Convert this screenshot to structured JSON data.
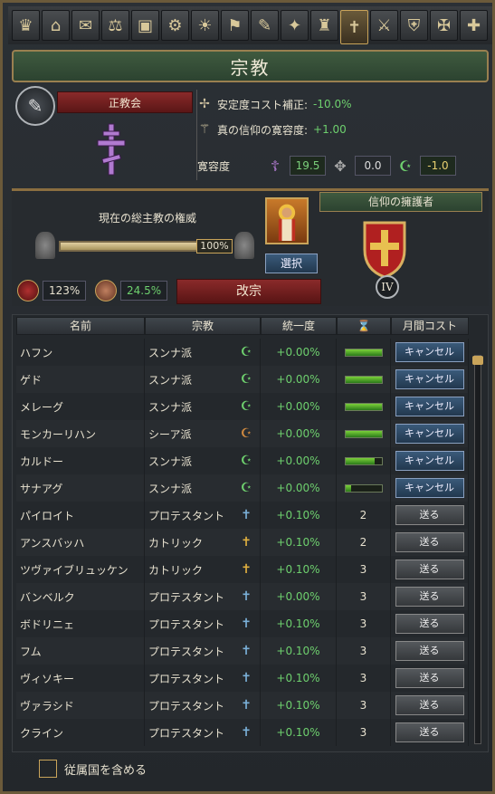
{
  "title": "宗教",
  "religion": {
    "name": "正教会"
  },
  "modifiers": [
    {
      "label": "安定度コスト補正:",
      "value": "-10.0%"
    },
    {
      "label": "真の信仰の寛容度:",
      "value": "+1.00"
    }
  ],
  "tolerance": {
    "label": "寛容度",
    "values": [
      "19.5",
      "0.0",
      "-1.0"
    ]
  },
  "authority": {
    "label": "現在の総主教の権威",
    "percent_text": "100%",
    "fill_fraction": 1.0
  },
  "select_label": "選択",
  "stats": {
    "left": "123%",
    "right": "24.5%"
  },
  "convert_label": "改宗",
  "defender": {
    "title": "信仰の擁護者",
    "rank": "IV"
  },
  "table": {
    "headers": [
      "名前",
      "宗教",
      "統一度",
      "",
      "月間コスト"
    ],
    "rows": [
      {
        "name": "ハフン",
        "religion": "スンナ派",
        "icon": "crescent-icon",
        "unity": "+0.00%",
        "time": "",
        "bar": 1.0,
        "action": "キャンセル"
      },
      {
        "name": "ゲド",
        "religion": "スンナ派",
        "icon": "crescent-icon",
        "unity": "+0.00%",
        "time": "",
        "bar": 1.0,
        "action": "キャンセル"
      },
      {
        "name": "メレーグ",
        "religion": "スンナ派",
        "icon": "crescent-icon",
        "unity": "+0.00%",
        "time": "",
        "bar": 1.0,
        "action": "キャンセル"
      },
      {
        "name": "モンカーリハン",
        "religion": "シーア派",
        "icon": "shia-crescent-icon",
        "unity": "+0.00%",
        "time": "",
        "bar": 1.0,
        "action": "キャンセル"
      },
      {
        "name": "カルドー",
        "religion": "スンナ派",
        "icon": "crescent-icon",
        "unity": "+0.00%",
        "time": "",
        "bar": 0.8,
        "action": "キャンセル"
      },
      {
        "name": "サナアグ",
        "religion": "スンナ派",
        "icon": "crescent-icon",
        "unity": "+0.00%",
        "time": "",
        "bar": 0.15,
        "action": "キャンセル"
      },
      {
        "name": "パイロイト",
        "religion": "プロテスタント",
        "icon": "protestant-cross-icon",
        "unity": "+0.10%",
        "time": "2",
        "action": "送る"
      },
      {
        "name": "アンスバッハ",
        "religion": "カトリック",
        "icon": "catholic-cross-icon",
        "unity": "+0.10%",
        "time": "2",
        "action": "送る"
      },
      {
        "name": "ツヴァイブリュッケン",
        "religion": "カトリック",
        "icon": "catholic-cross-icon",
        "unity": "+0.10%",
        "time": "3",
        "action": "送る"
      },
      {
        "name": "バンベルク",
        "religion": "プロテスタント",
        "icon": "protestant-cross-icon",
        "unity": "+0.00%",
        "time": "3",
        "action": "送る"
      },
      {
        "name": "ボドリニェ",
        "religion": "プロテスタント",
        "icon": "protestant-cross-icon",
        "unity": "+0.10%",
        "time": "3",
        "action": "送る"
      },
      {
        "name": "フム",
        "religion": "プロテスタント",
        "icon": "protestant-cross-icon",
        "unity": "+0.10%",
        "time": "3",
        "action": "送る"
      },
      {
        "name": "ヴィソキー",
        "religion": "プロテスタント",
        "icon": "protestant-cross-icon",
        "unity": "+0.10%",
        "time": "3",
        "action": "送る"
      },
      {
        "name": "ヴァラシド",
        "religion": "プロテスタント",
        "icon": "protestant-cross-icon",
        "unity": "+0.10%",
        "time": "3",
        "action": "送る"
      },
      {
        "name": "クライン",
        "religion": "プロテスタント",
        "icon": "protestant-cross-icon",
        "unity": "+0.10%",
        "time": "3",
        "action": "送る"
      }
    ]
  },
  "footer": {
    "checkbox_label": "従属国を含める"
  },
  "colors": {
    "accent_gold": "#c9a45a",
    "positive": "#6ed06e",
    "banner_red": "#8a2a2a",
    "title_green": "#3f5a3f"
  }
}
